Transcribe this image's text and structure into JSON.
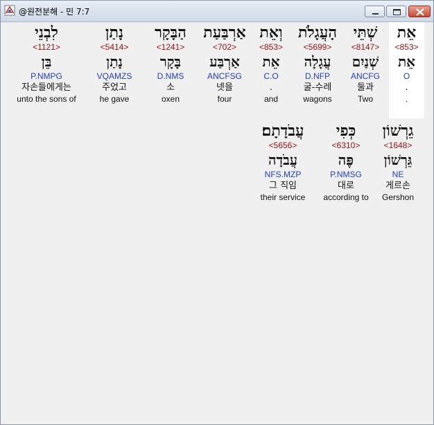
{
  "window": {
    "title": "@원전분해 - 민 7:7"
  },
  "rows": [
    [
      {
        "heb": "אֵת",
        "strong": "<853>",
        "lemma": "אֵת",
        "morph": "O",
        "kor": ".",
        "eng": "."
      },
      {
        "heb": "שְׁתֵּי",
        "strong": "<8147>",
        "lemma": "שְׁנַיִם",
        "morph": "ANCFG",
        "kor": "둘과",
        "eng": "Two"
      },
      {
        "heb": "הָעֲגָלֹת",
        "strong": "<5699>",
        "lemma": "עֲגָלָה",
        "morph": "D.NFP",
        "kor": "굴-수레",
        "eng": "wagons"
      },
      {
        "heb": "וְאֵת",
        "strong": "<853>",
        "lemma": "אֵת",
        "morph": "C.O",
        "kor": ".",
        "eng": "and"
      },
      {
        "heb": "אַרְבַּעַת",
        "strong": "<702>",
        "lemma": "אַרְבַּע",
        "morph": "ANCFSG",
        "kor": "넷을",
        "eng": "four"
      },
      {
        "heb": "הַבָּקָר",
        "strong": "<1241>",
        "lemma": "בָּקָר",
        "morph": "D.NMS",
        "kor": "소",
        "eng": "oxen"
      },
      {
        "heb": "נָתַן",
        "strong": "<5414>",
        "lemma": "נָתַן",
        "morph": "VQAMZS",
        "kor": "주었고",
        "eng": "he gave"
      },
      {
        "heb": "לִבְנֵי",
        "strong": "<1121>",
        "lemma": "בֵּן",
        "morph": "P.NMPG",
        "kor": "자손들에게는",
        "eng": "unto the sons of"
      }
    ],
    [
      {
        "heb": "גֵרְשׁוֹן",
        "strong": "<1648>",
        "lemma": "גֵּרְשׁוֹן",
        "morph": "NE",
        "kor": "게르손",
        "eng": "Gershon"
      },
      {
        "heb": "כְּפִי",
        "strong": "<6310>",
        "lemma": "פֶּה",
        "morph": "P.NMSG",
        "kor": "대로",
        "eng": "according to"
      },
      {
        "heb": "עֲבֹדָתָם׃",
        "strong": "<5656>",
        "lemma": "עֲבֹדָה",
        "morph": "NFS.MZP",
        "kor": "그 직임",
        "eng": "their service"
      }
    ]
  ]
}
